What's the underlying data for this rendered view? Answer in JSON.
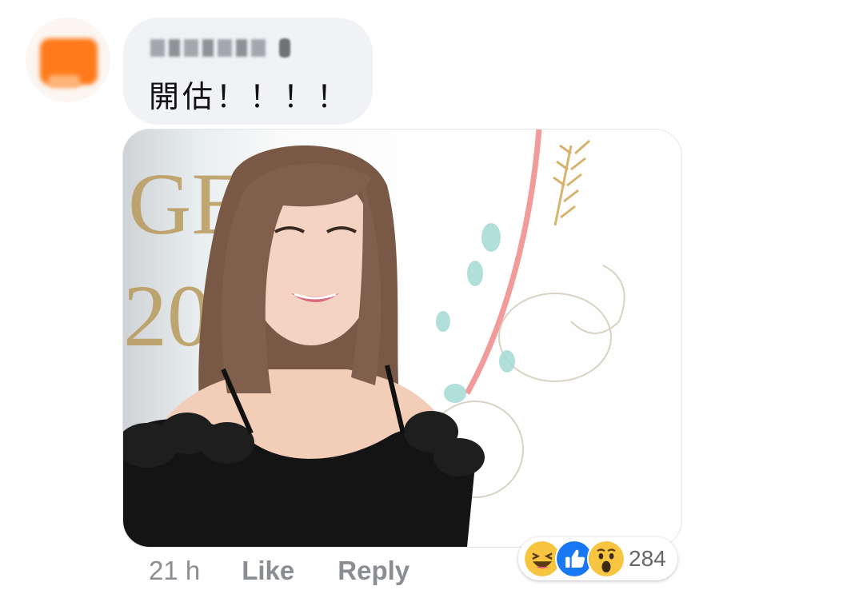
{
  "comment": {
    "author_name": "",
    "text": "開估！！！！"
  },
  "actions": {
    "time": "21 h",
    "like_label": "Like",
    "reply_label": "Reply"
  },
  "reactions": {
    "icons": [
      "haha-icon",
      "like-icon",
      "wow-icon"
    ],
    "count": "284"
  },
  "colors": {
    "bubble_bg": "#f0f2f5",
    "action_text": "#8a8d91",
    "like_blue": "#1877f2",
    "emoji_yellow": "#f7c53f"
  }
}
